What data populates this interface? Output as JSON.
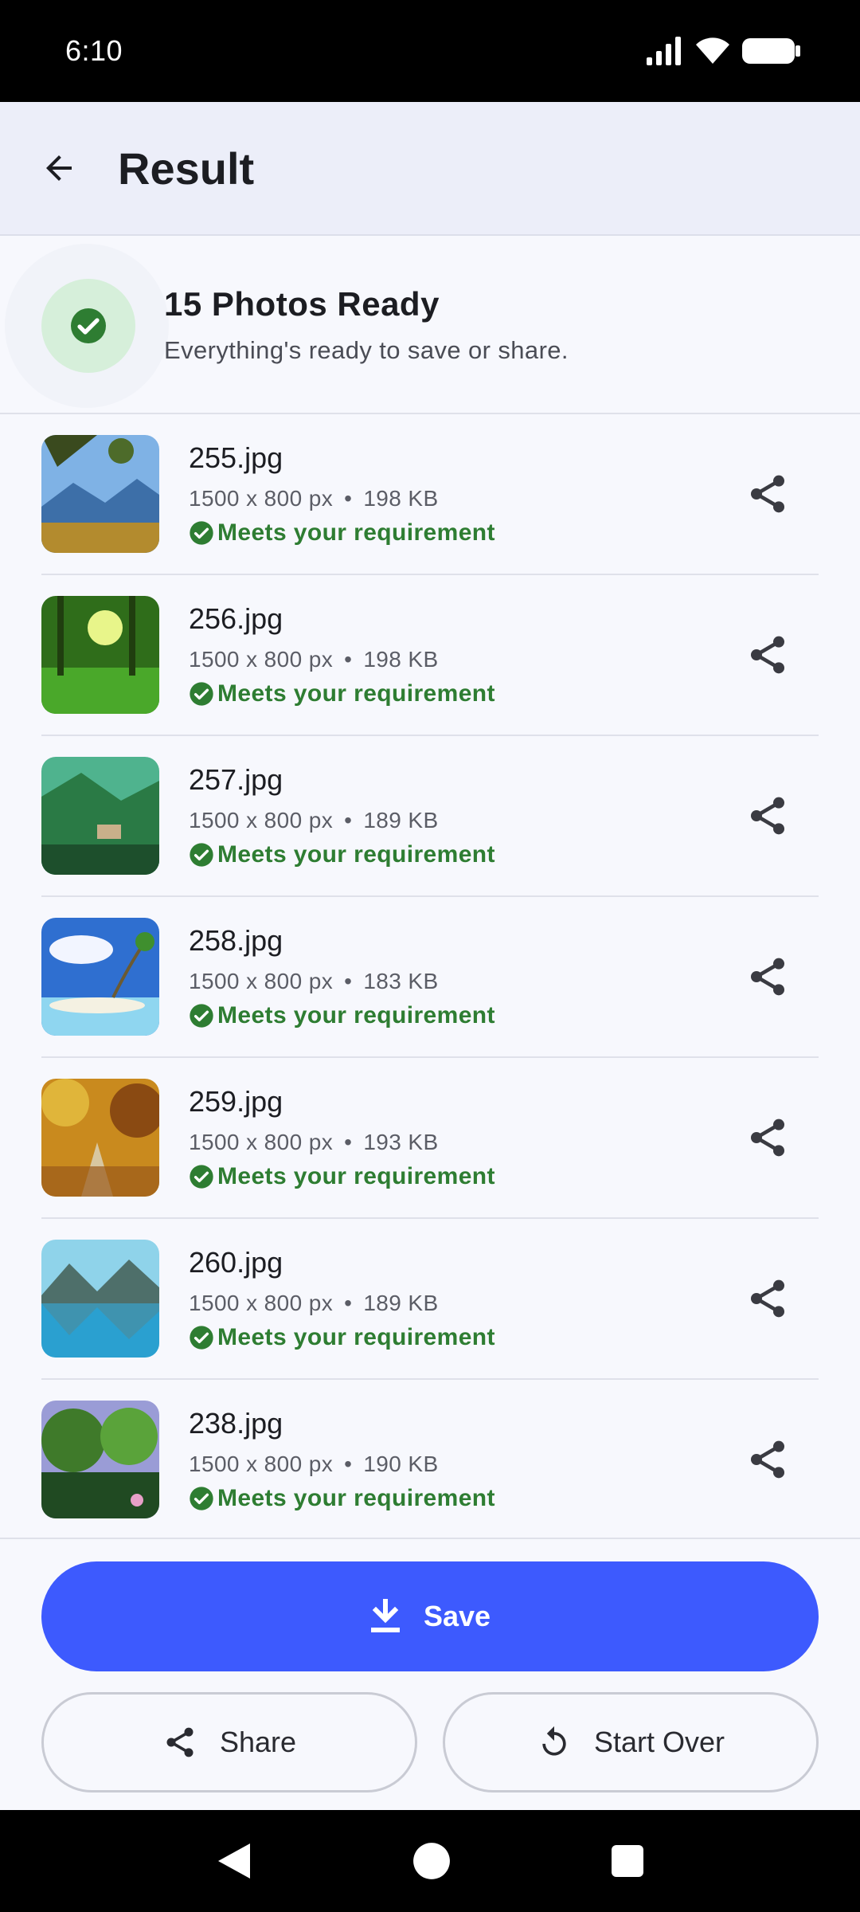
{
  "status_bar": {
    "time": "6:10"
  },
  "app_bar": {
    "title": "Result"
  },
  "summary": {
    "title": "15 Photos Ready",
    "subtitle": "Everything's ready to save or share."
  },
  "photos": [
    {
      "name": "255.jpg",
      "dimensions": "1500 x 800 px",
      "size": "198 KB",
      "status": "Meets your requirement"
    },
    {
      "name": "256.jpg",
      "dimensions": "1500 x 800 px",
      "size": "198 KB",
      "status": "Meets your requirement"
    },
    {
      "name": "257.jpg",
      "dimensions": "1500 x 800 px",
      "size": "189 KB",
      "status": "Meets your requirement"
    },
    {
      "name": "258.jpg",
      "dimensions": "1500 x 800 px",
      "size": "183 KB",
      "status": "Meets your requirement"
    },
    {
      "name": "259.jpg",
      "dimensions": "1500 x 800 px",
      "size": "193 KB",
      "status": "Meets your requirement"
    },
    {
      "name": "260.jpg",
      "dimensions": "1500 x 800 px",
      "size": "189 KB",
      "status": "Meets your requirement"
    },
    {
      "name": "238.jpg",
      "dimensions": "1500 x 800 px",
      "size": "190 KB",
      "status": "Meets your requirement"
    }
  ],
  "actions": {
    "save_label": "Save",
    "share_label": "Share",
    "start_over_label": "Start Over"
  },
  "colors": {
    "accent": "#3d5afe",
    "success": "#2e7d32",
    "app_bar_bg": "#eceef9"
  }
}
